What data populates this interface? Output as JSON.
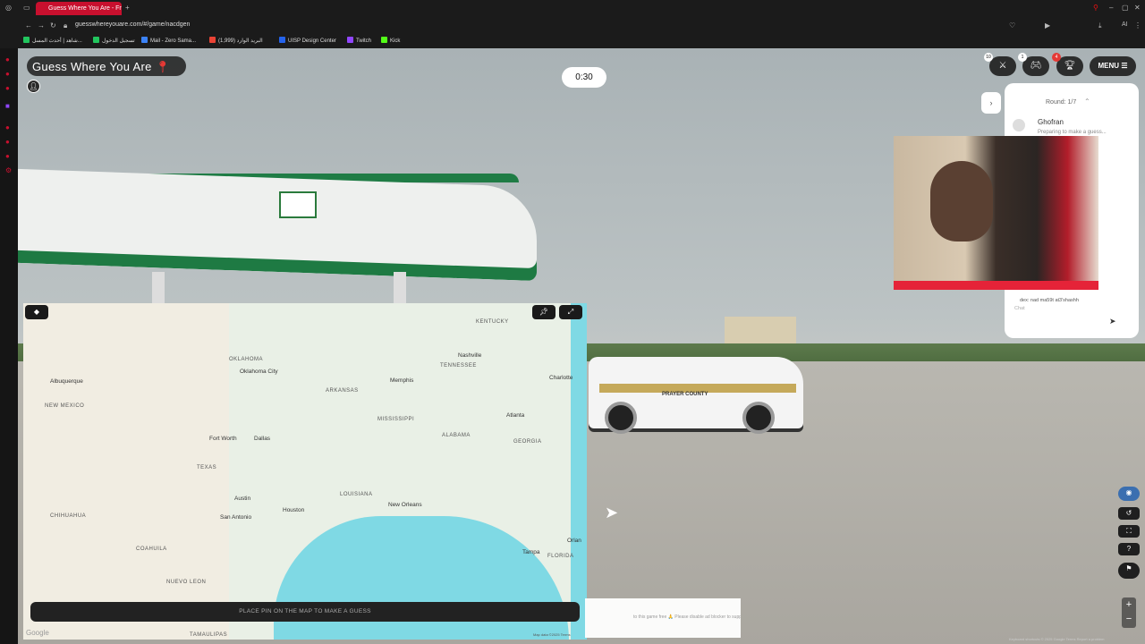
{
  "browser": {
    "tab_title": "Guess Where You Are - Fr",
    "url": "guesswhereyouare.com/#/game/nacdgen",
    "bookmarks": [
      {
        "label": "شاهد | أحدث المسل...",
        "color": "#22c55e"
      },
      {
        "label": "تسجيل الدخول",
        "color": "#22c55e"
      },
      {
        "label": "Mail - Zero Sama...",
        "color": "#3b82f6"
      },
      {
        "label": "البريد الوارد (1,999)",
        "color": "#ea4335"
      },
      {
        "label": "UISP Design Center",
        "color": "#2563eb"
      },
      {
        "label": "Twitch",
        "color": "#9146ff"
      },
      {
        "label": "Kick",
        "color": "#53fc18"
      }
    ],
    "toolbar_right_label": "AI"
  },
  "game": {
    "title": "Guess Where You Are",
    "timer": "0:30",
    "controls": [
      {
        "icon": "swords-icon",
        "badge": "10"
      },
      {
        "icon": "gamepad-icon",
        "badge": "1"
      },
      {
        "icon": "trophy-icon",
        "badge": "4"
      }
    ],
    "menu_label": "MENU",
    "round_label": "Round: 1/7",
    "player": {
      "name": "Ghofran",
      "status": "Preparing to make a guess..."
    },
    "chat": {
      "last_message": "dex: nad ma59t at3'shashh",
      "input_placeholder": "Chat"
    },
    "guess_bar": "PLACE PIN ON THE MAP TO MAKE A GUESS",
    "notice": "to this game free 🙏 Please disable ad blocker to support us ❤️",
    "truck_text": "PRAYER COUNTY"
  },
  "map": {
    "states": [
      "OKLAHOMA",
      "ARKANSAS",
      "TENNESSEE",
      "KENTUCKY",
      "MISSISSIPPI",
      "ALABAMA",
      "GEORGIA",
      "LOUISIANA",
      "TEXAS",
      "NEW MEXICO",
      "CHIHUAHUA",
      "COAHUILA",
      "NUEVO LEON",
      "TAMAULIPAS",
      "FLORIDA"
    ],
    "cities": [
      "Oklahoma City",
      "Albuquerque",
      "Fort Worth",
      "Dallas",
      "Austin",
      "San Antonio",
      "Houston",
      "New Orleans",
      "Memphis",
      "Nashville",
      "Atlanta",
      "Charlotte",
      "Tampa",
      "Orlan"
    ],
    "google": "Google",
    "footer": "Map data ©2025   Terms"
  },
  "streetview": {
    "attribution": "Keyboard shortcuts   © 2025 Google   Terms   Report a problem"
  }
}
